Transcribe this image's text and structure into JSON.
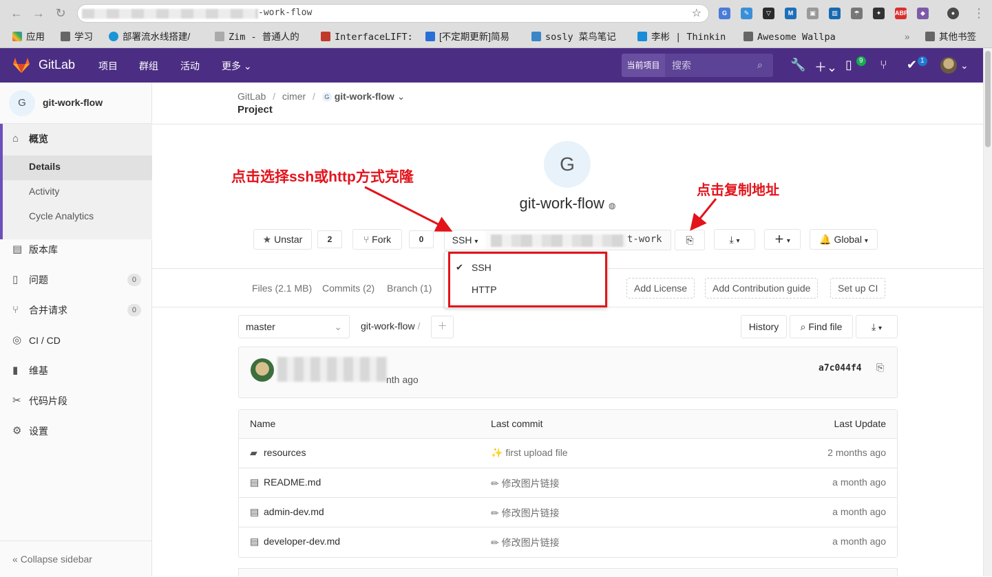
{
  "browser": {
    "url_suffix": "-work-flow",
    "bookmarks": [
      {
        "label": "应用",
        "color": "#e8453c"
      },
      {
        "label": "学习",
        "color": "#555555"
      },
      {
        "label": "部署流水线搭建/",
        "color": "#1a95d6"
      },
      {
        "label": "Zim - 普通人的",
        "color": "#777777"
      },
      {
        "label": "InterfaceLIFT:",
        "color": "#c0392b"
      },
      {
        "label": "[不定期更新]简易",
        "color": "#2a6fd6"
      },
      {
        "label": "sosly 菜鸟笔记",
        "color": "#3a86c8"
      },
      {
        "label": "李彬 | Thinkin",
        "color": "#1a8cd8"
      },
      {
        "label": "Awesome Wallpa",
        "color": "#666666"
      }
    ],
    "more_bookmarks": "»",
    "other_bookmarks": "其他书签"
  },
  "header": {
    "brand": "GitLab",
    "nav": [
      "项目",
      "群组",
      "活动",
      "更多"
    ],
    "search_scope": "当前项目",
    "search_placeholder": "搜索",
    "todo_count": "9",
    "issues_count": "1"
  },
  "sidebar": {
    "project_initial": "G",
    "project_name": "git-work-flow",
    "overview": "概览",
    "overview_sub": [
      "Details",
      "Activity",
      "Cycle Analytics"
    ],
    "items": [
      {
        "label": "版本库",
        "icon": "repository-icon"
      },
      {
        "label": "问题",
        "icon": "issues-icon",
        "count": "0"
      },
      {
        "label": "合并请求",
        "icon": "merge-request-icon",
        "count": "0"
      },
      {
        "label": "CI / CD",
        "icon": "ci-cd-icon"
      },
      {
        "label": "维基",
        "icon": "wiki-icon"
      },
      {
        "label": "代码片段",
        "icon": "snippets-icon"
      },
      {
        "label": "设置",
        "icon": "settings-icon"
      }
    ],
    "collapse": "Collapse sidebar"
  },
  "breadcrumb": {
    "items": [
      "GitLab",
      "cimer",
      "git-work-flow"
    ],
    "title": "Project"
  },
  "project": {
    "initial": "G",
    "title": "git-work-flow",
    "star_label": "Unstar",
    "star_count": "2",
    "fork_label": "Fork",
    "fork_count": "0",
    "clone_protocol": "SSH",
    "clone_url_suffix": "t-work",
    "notification": "Global"
  },
  "project_nav": {
    "links": [
      "Files (2.1 MB)",
      "Commits (2)",
      "Branch (1)"
    ],
    "boxes": [
      "Add License",
      "Add Contribution guide",
      "Set up CI"
    ]
  },
  "tree": {
    "branch": "master",
    "path": "git-work-flow",
    "history": "History",
    "find_file": "Find file"
  },
  "commit": {
    "time": "nth ago",
    "sha": "a7c044f4"
  },
  "files": {
    "headers": [
      "Name",
      "Last commit",
      "Last Update"
    ],
    "rows": [
      {
        "name": "resources",
        "type": "folder",
        "commit": "first upload file",
        "date": "2 months ago"
      },
      {
        "name": "README.md",
        "type": "file",
        "commit": "修改图片链接",
        "date": "a month ago"
      },
      {
        "name": "admin-dev.md",
        "type": "file",
        "commit": "修改图片链接",
        "date": "a month ago"
      },
      {
        "name": "developer-dev.md",
        "type": "file",
        "commit": "修改图片链接",
        "date": "a month ago"
      }
    ]
  },
  "clone_dropdown": {
    "options": [
      "SSH",
      "HTTP"
    ],
    "selected": "SSH"
  },
  "annotations": {
    "clone_hint": "点击选择ssh或http方式克隆",
    "copy_hint": "点击复制地址",
    "color": "#e3131b"
  },
  "colors": {
    "header_bg": "#4b2e83",
    "accent": "#6b4fbb"
  }
}
